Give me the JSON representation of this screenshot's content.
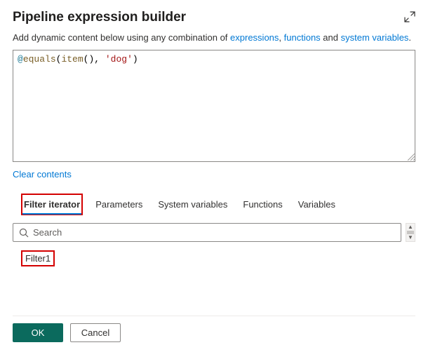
{
  "header": {
    "title": "Pipeline expression builder"
  },
  "subtitle": {
    "prefix": "Add dynamic content below using any combination of ",
    "expressions": "expressions",
    "sep1": ", ",
    "functions": "functions",
    "sep2": " and ",
    "system_variables": "system variables",
    "suffix": "."
  },
  "editor": {
    "at": "@",
    "equals": "equals",
    "lp": "(",
    "item": "item",
    "paren": "()",
    "comma": ", ",
    "str": "'dog'",
    "rp": ")"
  },
  "clear_contents": "Clear contents",
  "tabs": {
    "filter_iterator": "Filter iterator",
    "parameters": "Parameters",
    "system_variables": "System variables",
    "functions": "Functions",
    "variables": "Variables"
  },
  "search": {
    "placeholder": "Search"
  },
  "list": {
    "item1": "Filter1"
  },
  "footer": {
    "ok": "OK",
    "cancel": "Cancel"
  }
}
